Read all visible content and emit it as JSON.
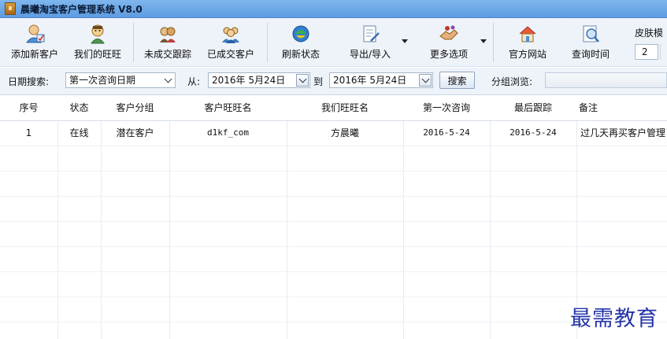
{
  "window": {
    "title": "晨曦淘宝客户管理系统 V8.0"
  },
  "toolbar": {
    "buttons": [
      {
        "label": "添加新客户",
        "icon": "add-customer-icon"
      },
      {
        "label": "我们的旺旺",
        "icon": "our-wangwang-icon"
      },
      {
        "label": "未成交跟踪",
        "icon": "unclosed-tracking-icon"
      },
      {
        "label": "已成交客户",
        "icon": "closed-customers-icon"
      },
      {
        "label": "刷新状态",
        "icon": "refresh-icon"
      },
      {
        "label": "导出/导入",
        "icon": "export-import-icon"
      },
      {
        "label": "更多选项",
        "icon": "more-options-icon"
      },
      {
        "label": "官方网站",
        "icon": "home-website-icon"
      },
      {
        "label": "查询时间",
        "icon": "query-time-icon"
      }
    ],
    "skin_label": "皮肤模",
    "skin_value": "2"
  },
  "filter": {
    "date_search_label": "日期搜索:",
    "date_type": "第一次咨询日期",
    "from_label": "从:",
    "from_date": "2016年 5月24日",
    "to_label": "到",
    "to_date": "2016年 5月24日",
    "search_button": "搜索",
    "group_label": "分组浏览:"
  },
  "table": {
    "columns": [
      "序号",
      "状态",
      "客户分组",
      "客户旺旺名",
      "我们旺旺名",
      "第一次咨询",
      "最后跟踪",
      "备注"
    ],
    "rows": [
      {
        "index": "1",
        "status": "在线",
        "group": "潜在客户",
        "customer_ww": "d1kf_com",
        "our_ww": "方晨曦",
        "first_consult": "2016-5-24",
        "last_follow": "2016-5-24",
        "note": "过几天再买客户管理"
      }
    ]
  },
  "watermark": "最需教育",
  "colors": {
    "titlebar": "#6fa8e8",
    "toolbar_bg": "#eef3fa",
    "watermark": "#2436a8"
  }
}
